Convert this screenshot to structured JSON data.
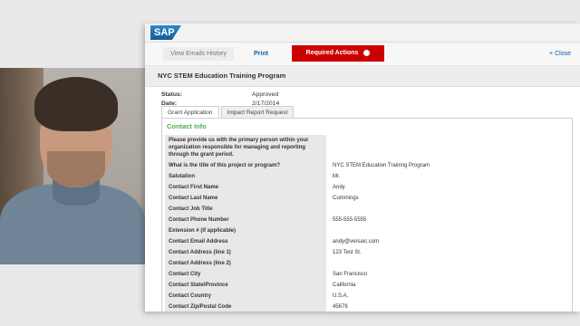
{
  "header": {
    "brand": "SAP"
  },
  "toolbar": {
    "emails_history": "View Emails History",
    "print": "Print",
    "required_actions": "Required Actions",
    "close": "Close"
  },
  "page": {
    "title": "NYC STEM Education Training Program",
    "status_label": "Status:",
    "status_value": "Approved",
    "date_label": "Date:",
    "date_value": "2/17/2014"
  },
  "tabs": [
    "Grant Application",
    "Impact Report Request"
  ],
  "section": {
    "title": "Contact Info"
  },
  "rows": [
    {
      "label": "Please provide us with the primary person within your organization responsible for managing and reporting through the grant period.",
      "value": ""
    },
    {
      "label": "What is the title of this project or program?",
      "value": "NYC STEM Education Training Program"
    },
    {
      "label": "Salutation",
      "value": "Mr."
    },
    {
      "label": "Contact First Name",
      "value": "Andy"
    },
    {
      "label": "Contact Last Name",
      "value": "Cummings"
    },
    {
      "label": "Contact Job Title",
      "value": ""
    },
    {
      "label": "Contact Phone Number",
      "value": "555-555-5555"
    },
    {
      "label": "Extension # (if applicable)",
      "value": ""
    },
    {
      "label": "Contact Email Address",
      "value": "andy@versaic.com"
    },
    {
      "label": "Contact Address (line 1)",
      "value": "123 Test St."
    },
    {
      "label": "Contact Address (line 2)",
      "value": ""
    },
    {
      "label": "Contact City",
      "value": "San Francisco"
    },
    {
      "label": "Contact State/Province",
      "value": "California"
    },
    {
      "label": "Contact Country",
      "value": "U.S.A."
    },
    {
      "label": "Contact Zip/Postal Code",
      "value": "45678"
    }
  ]
}
